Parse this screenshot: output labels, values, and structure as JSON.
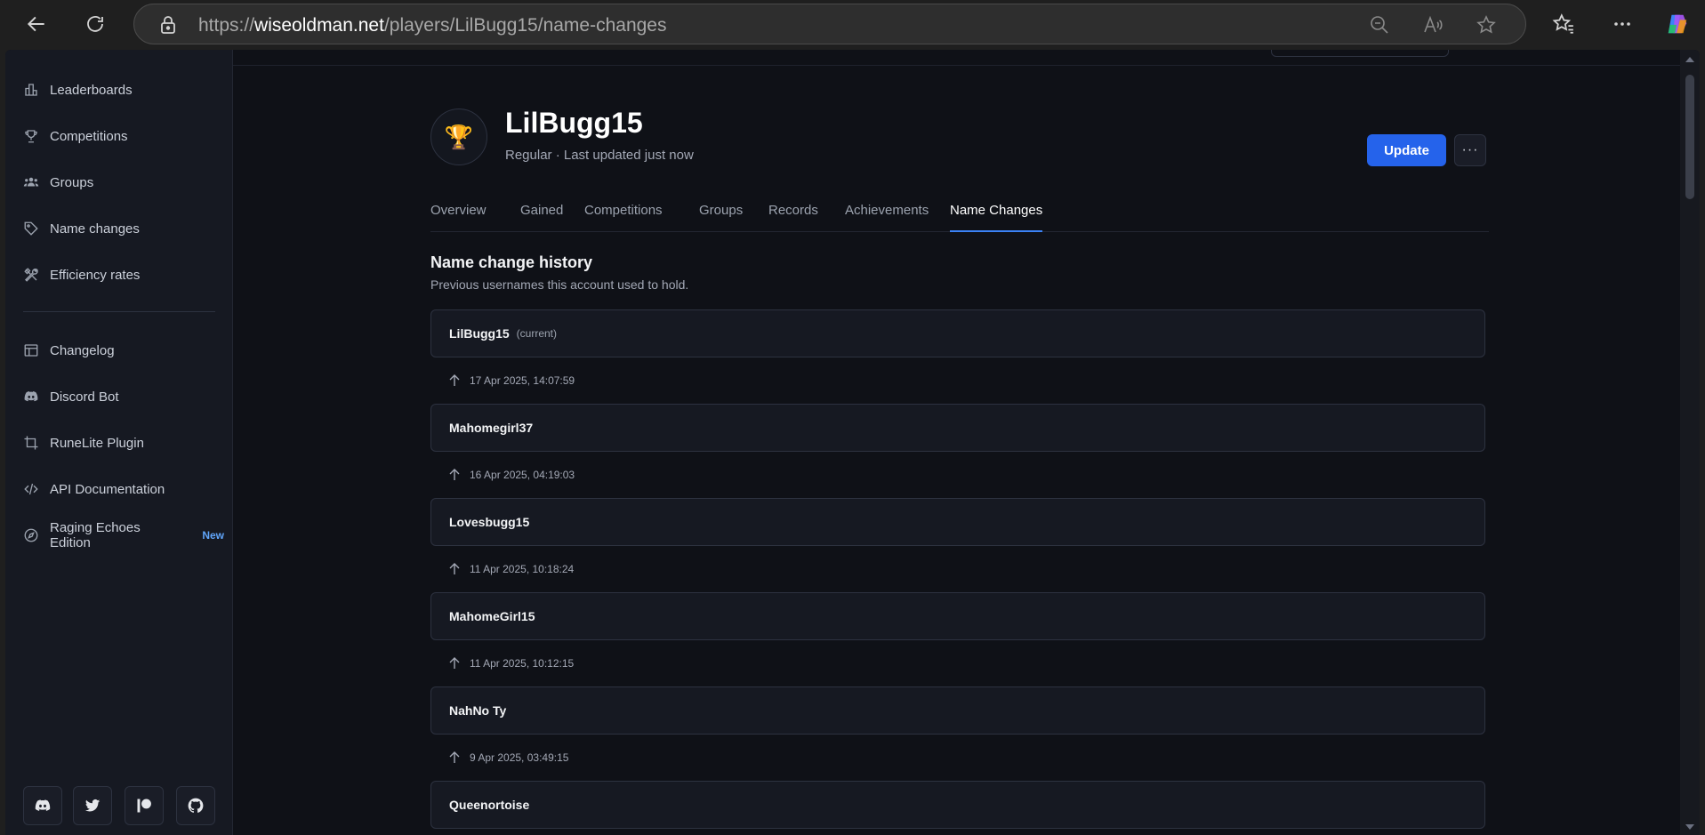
{
  "browser": {
    "url_prefix": "https://",
    "url_domain": "wiseoldman.net",
    "url_path": "/players/LilBugg15/name-changes"
  },
  "sidebar": {
    "items": [
      {
        "label": "Leaderboards",
        "icon": "bar-chart-icon"
      },
      {
        "label": "Competitions",
        "icon": "trophy-icon"
      },
      {
        "label": "Groups",
        "icon": "users-icon"
      },
      {
        "label": "Name changes",
        "icon": "tag-icon"
      },
      {
        "label": "Efficiency rates",
        "icon": "tools-icon"
      }
    ],
    "secondary": [
      {
        "label": "Changelog",
        "icon": "layout-icon"
      },
      {
        "label": "Discord Bot",
        "icon": "discord-icon"
      },
      {
        "label": "RuneLite Plugin",
        "icon": "crop-icon"
      },
      {
        "label": "API Documentation",
        "icon": "code-icon"
      },
      {
        "label": "Raging Echoes Edition",
        "icon": "compass-icon",
        "badge": "New"
      }
    ],
    "social": [
      "discord-icon",
      "twitter-icon",
      "patreon-icon",
      "github-icon"
    ]
  },
  "player": {
    "name": "LilBugg15",
    "subtitle": "Regular · Last updated just now",
    "update_label": "Update",
    "more_label": "···"
  },
  "tabs": [
    {
      "label": "Overview",
      "active": false
    },
    {
      "label": "Gained",
      "active": false
    },
    {
      "label": "Competitions",
      "active": false
    },
    {
      "label": "Groups",
      "active": false
    },
    {
      "label": "Records",
      "active": false
    },
    {
      "label": "Achievements",
      "active": false
    },
    {
      "label": "Name Changes",
      "active": true
    }
  ],
  "history": {
    "title": "Name change history",
    "subtitle": "Previous usernames this account used to hold.",
    "current_tag": "(current)",
    "names": [
      "LilBugg15",
      "Mahomegirl37",
      "Lovesbugg15",
      "MahomeGirl15",
      "NahNo Ty",
      "Queenortoise"
    ],
    "dates": [
      "17 Apr 2025, 14:07:59",
      "16 Apr 2025, 04:19:03",
      "11 Apr 2025, 10:18:24",
      "11 Apr 2025, 10:12:15",
      "9 Apr 2025, 03:49:15"
    ]
  },
  "colors": {
    "accent": "#2563eb",
    "tab_active_underline": "#3b82f6",
    "badge_new": "#60a5fa"
  }
}
